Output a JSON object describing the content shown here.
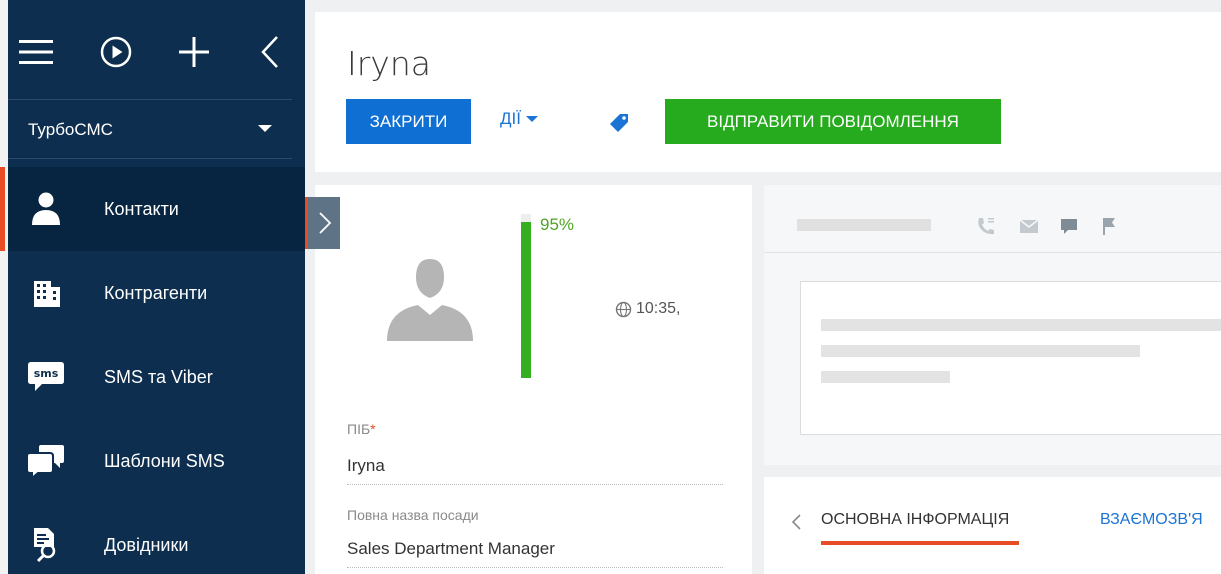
{
  "sidebar": {
    "top_icons": [
      "menu-icon",
      "play-icon",
      "plus-icon",
      "chevron-left-icon"
    ],
    "workspace": "ТурбоСМС",
    "items": [
      {
        "label": "Контакти",
        "icon": "contact-icon",
        "active": true
      },
      {
        "label": "Контрагенти",
        "icon": "building-icon",
        "active": false
      },
      {
        "label": "SMS та Viber",
        "icon": "sms-icon",
        "active": false
      },
      {
        "label": "Шаблони SMS",
        "icon": "chat-bubbles-icon",
        "active": false
      },
      {
        "label": "Довідники",
        "icon": "lookup-icon",
        "active": false
      }
    ]
  },
  "header": {
    "title": "Iryna",
    "close_label": "ЗАКРИТИ",
    "actions_label": "ДІЇ",
    "send_label": "ВІДПРАВИТИ ПОВІДОМЛЕННЯ"
  },
  "profile": {
    "completeness": "95%",
    "completeness_fraction": 0.95,
    "time": "10:35,",
    "name_label": "ПІБ",
    "required_mark": "*",
    "name_value": "Iryna",
    "position_label": "Повна назва посади",
    "position_value": "Sales Department Manager"
  },
  "tabs": {
    "active": "ОСНОВНА ІНФОРМАЦІЯ",
    "next": "ВЗАЄМОЗВ'Я"
  },
  "colors": {
    "sidebar_bg": "#0d2e4e",
    "accent_orange": "#e84c24",
    "primary_blue": "#0f6fd2",
    "success_green": "#27ab1e"
  }
}
